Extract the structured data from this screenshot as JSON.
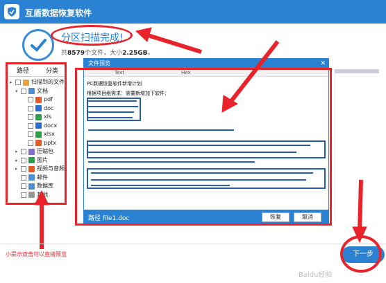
{
  "app": {
    "title": "互盾数据恢复软件"
  },
  "scan": {
    "title": "分区扫描完成!",
    "summary_prefix": "共",
    "file_count": "8579",
    "summary_mid": "个文件，大小",
    "size": "2.25GB",
    "summary_end": "。"
  },
  "left_tabs": [
    "路径",
    "分类"
  ],
  "tree": [
    {
      "label": "扫描到的文件",
      "icon": "folder-icon",
      "color": "#e8a33a",
      "level": 0,
      "expander": "▸"
    },
    {
      "label": "文档",
      "icon": "folder-icon",
      "color": "#4d8fd6",
      "level": 1,
      "expander": "▾"
    },
    {
      "label": "pdf",
      "icon": "file-icon",
      "color": "#e05a2a",
      "level": 2
    },
    {
      "label": "doc",
      "icon": "file-icon",
      "color": "#2c6fd0",
      "level": 2
    },
    {
      "label": "xls",
      "icon": "file-icon",
      "color": "#2aa04a",
      "level": 2
    },
    {
      "label": "docx",
      "icon": "file-icon",
      "color": "#2c6fd0",
      "level": 2
    },
    {
      "label": "xlsx",
      "icon": "file-icon",
      "color": "#2aa04a",
      "level": 2
    },
    {
      "label": "pptx",
      "icon": "file-icon",
      "color": "#e05a2a",
      "level": 2
    },
    {
      "label": "压缩包",
      "icon": "folder-icon",
      "color": "#8a6bd1",
      "level": 1,
      "expander": "▸"
    },
    {
      "label": "图片",
      "icon": "folder-icon",
      "color": "#2aa04a",
      "level": 1,
      "expander": "▸"
    },
    {
      "label": "视频与音频",
      "icon": "folder-icon",
      "color": "#e05a2a",
      "level": 1,
      "expander": "▸"
    },
    {
      "label": "邮件",
      "icon": "folder-icon",
      "color": "#4d8fd6",
      "level": 1
    },
    {
      "label": "数据库",
      "icon": "folder-icon",
      "color": "#4d8fd6",
      "level": 1
    },
    {
      "label": "其他",
      "icon": "folder-icon",
      "color": "#999999",
      "level": 1
    }
  ],
  "preview": {
    "title": "文件预览",
    "tab_text": "Text",
    "tab_hex": "Hex",
    "doc_title": "PC数据恢复软件新增计划",
    "doc_intro": "根据项目组需求：需要新增加下软件：",
    "path_label": "路径 file1.doc",
    "restore_button": "恢复",
    "cancel_button": "取消"
  },
  "hint": "小提示双击可以直接预览",
  "next_button": "下一步",
  "watermark": "Baidu经验",
  "colors": {
    "brand": "#2c82d2",
    "annotation": "#e8232a",
    "highlight": "#2a5db0"
  }
}
